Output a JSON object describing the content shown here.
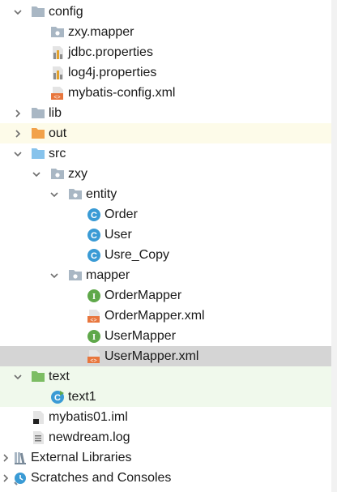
{
  "tree": [
    {
      "label": "config",
      "depth": 1,
      "icon": "folder-gray-icon",
      "arrow": "chevron-down"
    },
    {
      "label": "zxy.mapper",
      "depth": 2,
      "icon": "package-folder-icon"
    },
    {
      "label": "jdbc.properties",
      "depth": 2,
      "icon": "properties-file-icon"
    },
    {
      "label": "log4j.properties",
      "depth": 2,
      "icon": "properties-file-icon"
    },
    {
      "label": "mybatis-config.xml",
      "depth": 2,
      "icon": "xml-file-icon"
    },
    {
      "label": "lib",
      "depth": 1,
      "icon": "folder-gray-icon",
      "arrow": "chevron-right"
    },
    {
      "label": "out",
      "depth": 1,
      "icon": "folder-orange-icon",
      "arrow": "chevron-right",
      "highlight": "yellow"
    },
    {
      "label": "src",
      "depth": 1,
      "icon": "folder-blue-icon",
      "arrow": "chevron-down"
    },
    {
      "label": "zxy",
      "depth": 2,
      "icon": "package-folder-icon",
      "arrow": "chevron-down"
    },
    {
      "label": "entity",
      "depth": 3,
      "icon": "package-folder-icon",
      "arrow": "chevron-down"
    },
    {
      "label": "Order",
      "depth": 4,
      "icon": "class-icon"
    },
    {
      "label": "User",
      "depth": 4,
      "icon": "class-icon"
    },
    {
      "label": "Usre_Copy",
      "depth": 4,
      "icon": "class-icon"
    },
    {
      "label": "mapper",
      "depth": 3,
      "icon": "package-folder-icon",
      "arrow": "chevron-down"
    },
    {
      "label": "OrderMapper",
      "depth": 4,
      "icon": "interface-icon"
    },
    {
      "label": "OrderMapper.xml",
      "depth": 4,
      "icon": "xml-file-icon"
    },
    {
      "label": "UserMapper",
      "depth": 4,
      "icon": "interface-icon"
    },
    {
      "label": "UserMapper.xml",
      "depth": 4,
      "icon": "xml-file-icon",
      "highlight": "gray"
    },
    {
      "label": "text",
      "depth": 1,
      "icon": "folder-green-icon",
      "arrow": "chevron-down",
      "highlight": "green"
    },
    {
      "label": "text1",
      "depth": 2,
      "icon": "runnable-class-icon",
      "highlight": "green"
    },
    {
      "label": "mybatis01.iml",
      "depth": 1,
      "icon": "iml-file-icon"
    },
    {
      "label": "newdream.log",
      "depth": 1,
      "icon": "log-file-icon"
    },
    {
      "label": "External Libraries",
      "depth": 0,
      "icon": "libraries-icon",
      "arrow": "chevron-right"
    },
    {
      "label": "Scratches and Consoles",
      "depth": 0,
      "icon": "scratches-icon",
      "arrow": "chevron-right"
    }
  ],
  "colors": {
    "selection": "#d5d5d5",
    "excluded_highlight": "#fdfbe9",
    "test_highlight": "#f0f9ec",
    "class_icon": "#3a9bd5",
    "interface_icon": "#5fa84a",
    "xml_icon": "#e8763d"
  }
}
